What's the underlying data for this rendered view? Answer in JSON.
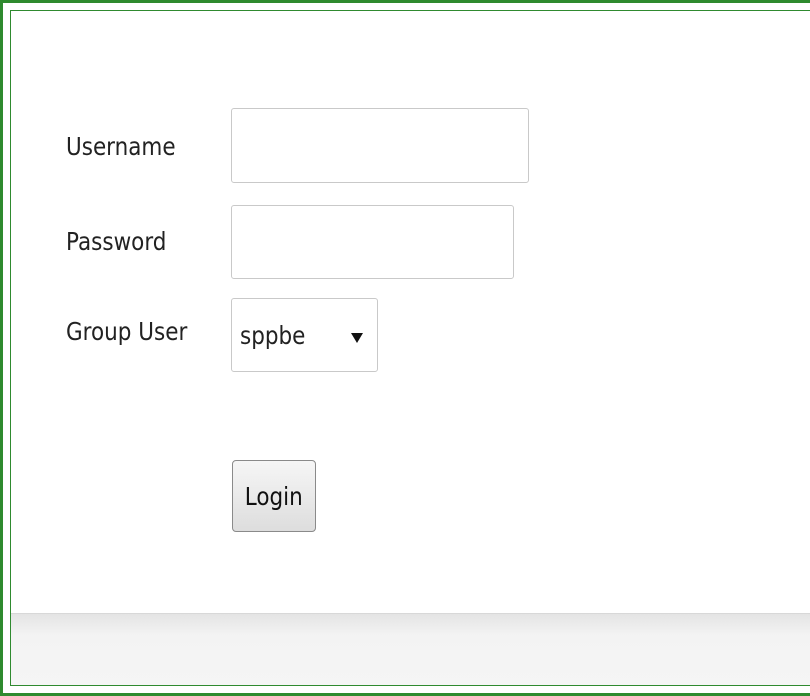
{
  "form": {
    "username_label": "Username",
    "username_value": "",
    "password_label": "Password",
    "password_value": "",
    "group_label": "Group User",
    "group_selected": "sppbe",
    "login_label": "Login"
  },
  "colors": {
    "frame_border": "#2f8a2f"
  },
  "icons": {
    "dropdown": "triangle-down"
  }
}
